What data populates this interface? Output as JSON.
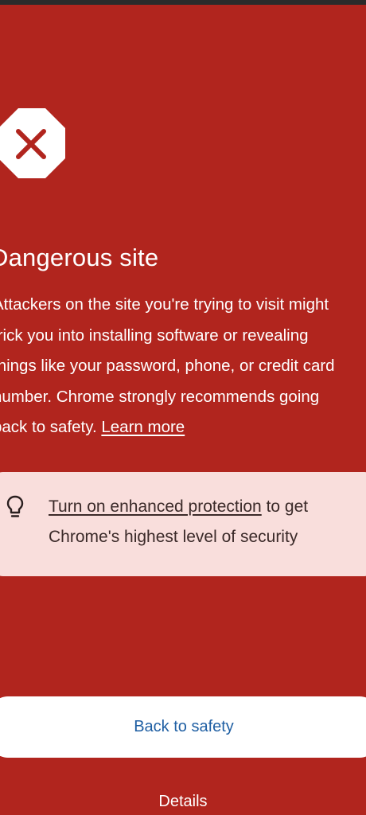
{
  "page": {
    "title": "Dangerous site",
    "body_lines": [
      "Attackers on the site you're trying to visit might",
      "trick you into installing software or revealing",
      "things like your password, phone, or credit card",
      "number. Chrome strongly recommends going",
      "back to safety."
    ],
    "learn_more_label": "Learn more",
    "icon": "close-octagon-icon"
  },
  "tip_card": {
    "icon": "lightbulb-icon",
    "link_label": "Turn on enhanced protection",
    "text_after_link": " to get",
    "second_line": "Chrome's highest level of security"
  },
  "actions": {
    "back_label": "Back to safety",
    "details_label": "Details"
  },
  "colors": {
    "background": "#b1251e",
    "card_background": "#f9dedc",
    "button_text": "#1f5fa3"
  }
}
